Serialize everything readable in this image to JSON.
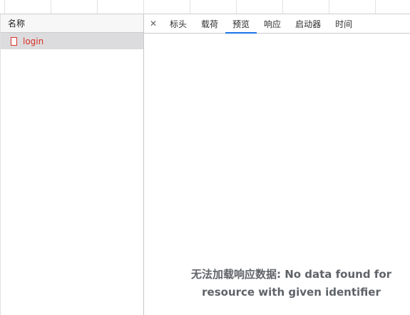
{
  "requests_panel": {
    "column_header": "名称",
    "rows": [
      {
        "name": "login",
        "status": "error",
        "status_color": "#d93025"
      }
    ]
  },
  "detail_panel": {
    "close_icon": "close-icon",
    "tabs": [
      "标头",
      "载荷",
      "预览",
      "响应",
      "启动器",
      "时间"
    ],
    "active_tab": "预览",
    "message_line1": "无法加载响应数据: No data found for",
    "message_line2": "resource with given identifier"
  },
  "colors": {
    "active_tab_underline": "#1a73e8",
    "selected_row_bg": "#dcdcde",
    "error_text": "#d93025"
  }
}
